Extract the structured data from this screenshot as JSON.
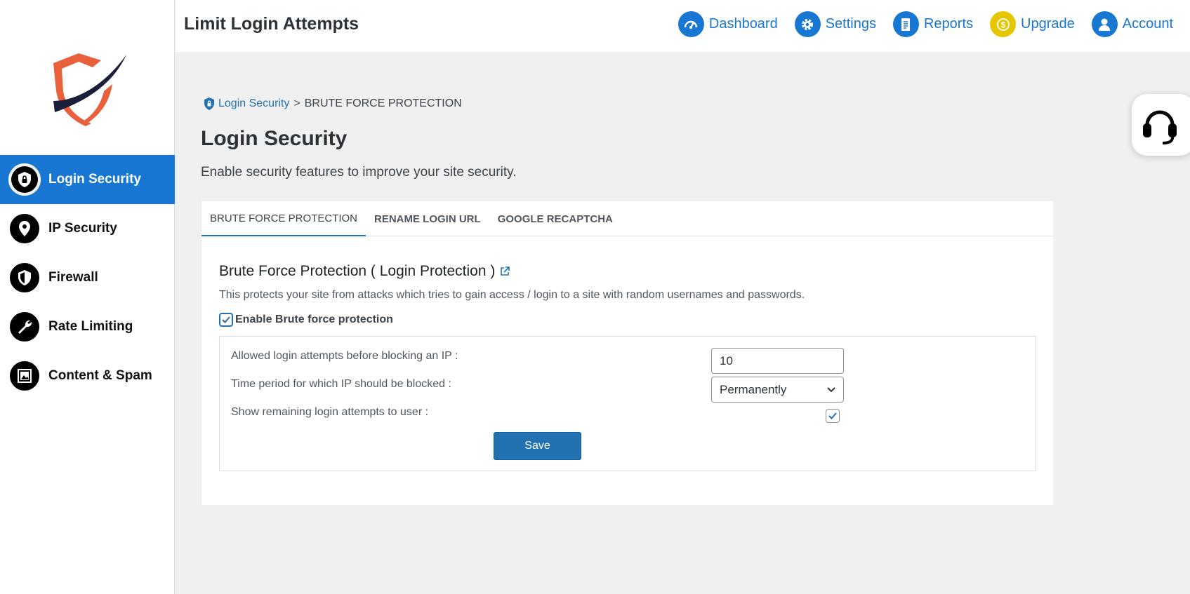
{
  "app": {
    "title": "Limit Login Attempts"
  },
  "top_nav": [
    {
      "label": "Dashboard",
      "icon": "dashboard-icon"
    },
    {
      "label": "Settings",
      "icon": "gear-icon"
    },
    {
      "label": "Reports",
      "icon": "document-icon"
    },
    {
      "label": "Upgrade",
      "icon": "dollar-icon",
      "color": "#e6c600"
    },
    {
      "label": "Account",
      "icon": "user-icon"
    }
  ],
  "sidebar": {
    "items": [
      {
        "label": "Login Security",
        "icon": "shield-lock-icon",
        "active": true
      },
      {
        "label": "IP Security",
        "icon": "location-pin-icon"
      },
      {
        "label": "Firewall",
        "icon": "shield-icon"
      },
      {
        "label": "Rate Limiting",
        "icon": "wrench-icon"
      },
      {
        "label": "Content & Spam",
        "icon": "image-frame-icon"
      }
    ]
  },
  "breadcrumb": {
    "link": "Login Security",
    "separator": ">",
    "current": "BRUTE FORCE PROTECTION"
  },
  "page": {
    "title": "Login Security",
    "subtitle": "Enable security features to improve your site security."
  },
  "tabs": [
    {
      "label": "BRUTE FORCE PROTECTION",
      "active": true
    },
    {
      "label": "RENAME LOGIN URL"
    },
    {
      "label": "GOOGLE RECAPTCHA"
    }
  ],
  "section": {
    "title": "Brute Force Protection ( Login Protection )",
    "description": "This protects your site from attacks which tries to gain access / login to a site with random usernames and passwords.",
    "enable_label": "Enable Brute force protection",
    "enabled": true
  },
  "settings": {
    "attempts_label": "Allowed login attempts before blocking an IP :",
    "attempts_value": "10",
    "period_label": "Time period for which IP should be blocked :",
    "period_value": "Permanently",
    "show_remaining_label": "Show remaining login attempts to user :",
    "show_remaining": true,
    "save_label": "Save"
  },
  "colors": {
    "accent": "#1877d2",
    "button": "#2271b1",
    "logo_orange": "#e8603c",
    "logo_navy": "#1b1f3b"
  }
}
